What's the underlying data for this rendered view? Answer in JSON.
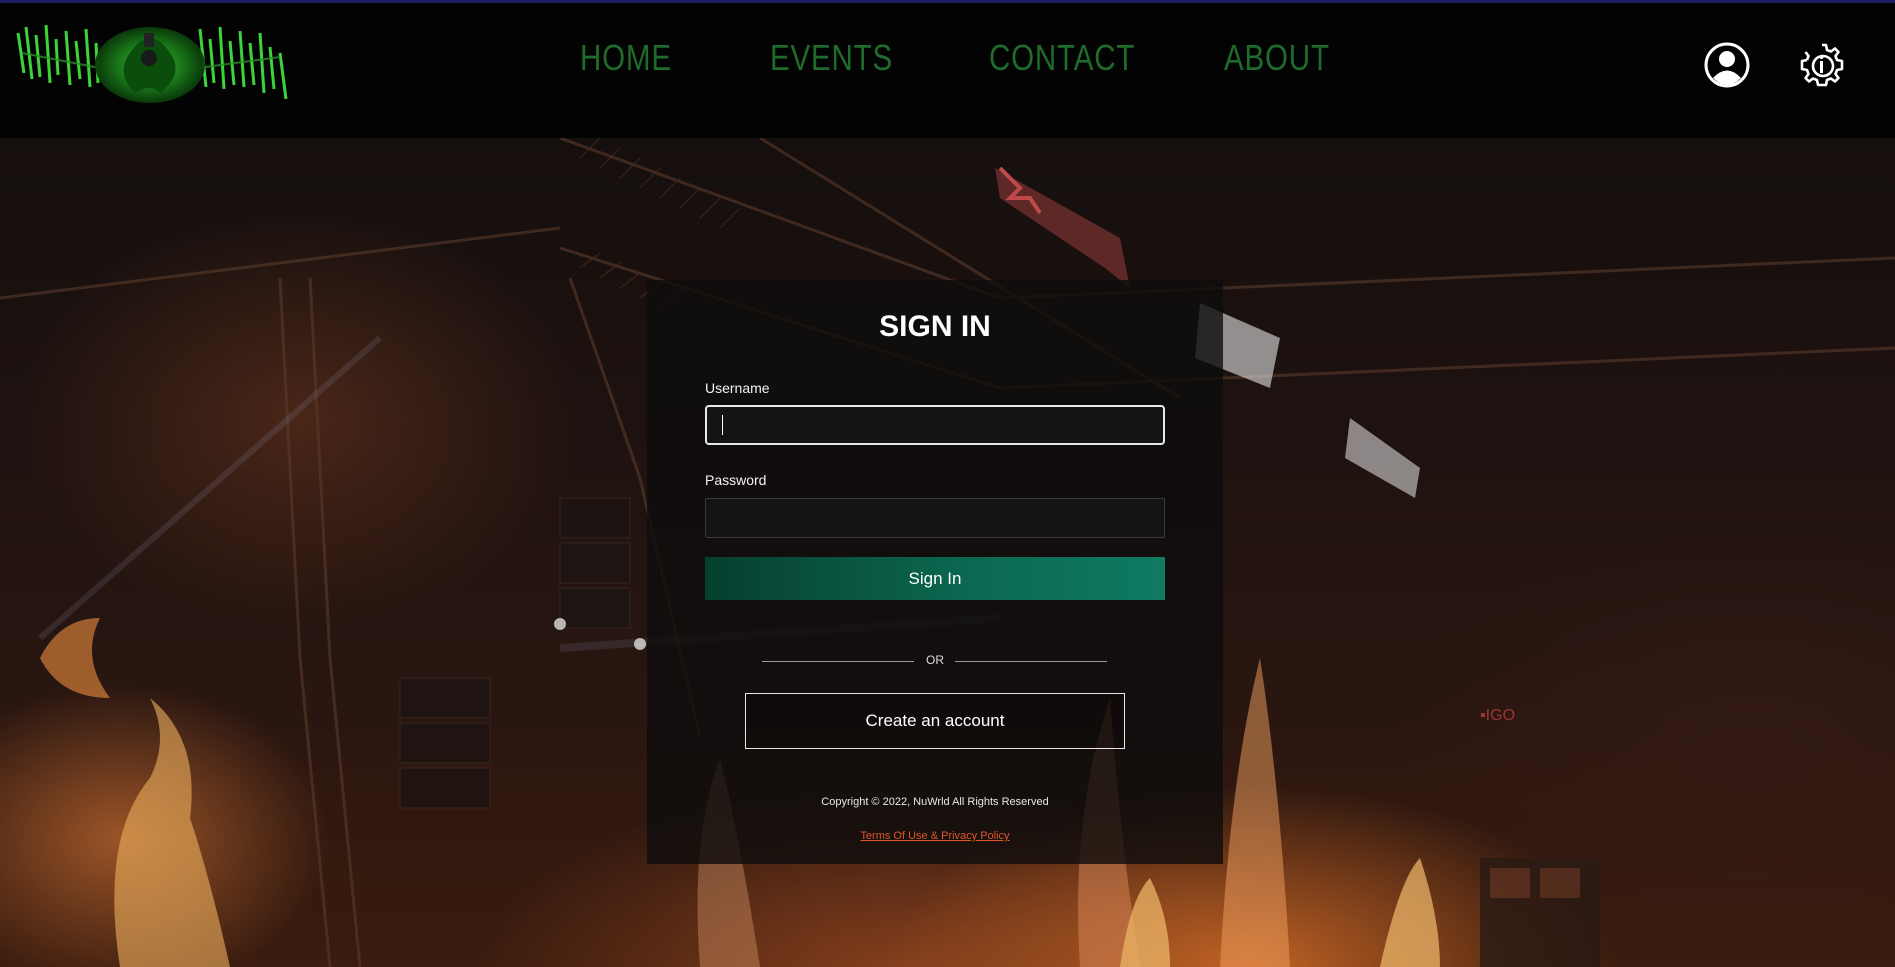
{
  "nav": {
    "items": [
      {
        "label": "HOME"
      },
      {
        "label": "EVENTS"
      },
      {
        "label": "CONTACT"
      },
      {
        "label": "ABOUT"
      }
    ],
    "icons": [
      "user-account-icon",
      "settings-gear-icon"
    ]
  },
  "signin": {
    "title": "SIGN IN",
    "username_label": "Username",
    "username_value": "",
    "password_label": "Password",
    "password_value": "",
    "submit_label": "Sign In",
    "divider_text": "OR",
    "create_account_label": "Create an account",
    "copyright": "Copyright © 2022, NuWrld All Rights Reserved",
    "terms_link": "Terms Of Use & Privacy Policy"
  },
  "colors": {
    "nav_text": "#1e6b2c",
    "button_green": "#0c6a52",
    "terms_link": "#e0562a",
    "header_bg": "#030303"
  }
}
